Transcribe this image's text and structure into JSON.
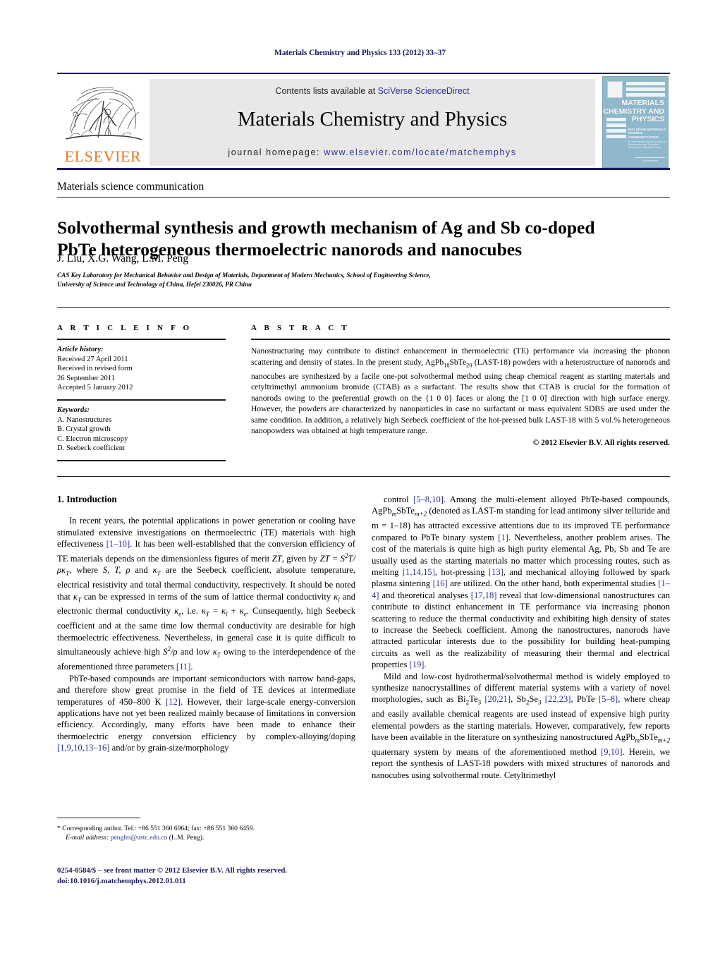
{
  "running_head": "Materials Chemistry and Physics 133 (2012) 33–37",
  "header": {
    "contents_prefix": "Contents lists available at ",
    "contents_link": "SciVerse ScienceDirect",
    "journal_name": "Materials Chemistry and Physics",
    "homepage_prefix": "journal homepage: ",
    "homepage_link": "www.elsevier.com/locate/matchemphys",
    "publisher_wordmark": "ELSEVIER",
    "publisher_color": "#e87722",
    "link_color": "#2e3192",
    "rule_color": "#1b1b5e",
    "banner_bg": "#e8e8e8"
  },
  "cover": {
    "title_line1": "MATERIALS",
    "title_line2": "CHEMISTRY AND",
    "title_line3": "PHYSICS",
    "subtitle": "INCLUDING MATERIALS SCIENCE COMMUNICATIONS",
    "fine_print": "An International Journal devoted to Experimental and Theoretical Research on Materials Science",
    "foot": "ScienceDirect",
    "bg_color": "#8fb8cc"
  },
  "article": {
    "section_label": "Materials science communication",
    "title": "Solvothermal synthesis and growth mechanism of Ag and Sb co-doped PbTe heterogeneous thermoelectric nanorods and nanocubes",
    "authors": "J. Liu, X.G. Wang, L.M. Peng",
    "corresponding_marker": "*",
    "affiliation_line1": "CAS Key Laboratory for Mechanical Behavior and Design of Materials, Department of Modern Mechanics, School of Engineering Science,",
    "affiliation_line2": "University of Science and Technology of China, Hefei 230026, PR China"
  },
  "article_info": {
    "heading": "A R T I C L E   I N F O",
    "history_label": "Article history:",
    "history": [
      "Received 27 April 2011",
      "Received in revised form",
      "26 September 2011",
      "Accepted 5 January 2012"
    ],
    "keywords_label": "Keywords:",
    "keywords": [
      "A. Nanostructures",
      "B. Crystal growth",
      "C. Electron microscopy",
      "D. Seebeck coefficient"
    ]
  },
  "abstract": {
    "heading": "A B S T R A C T",
    "text_part1": "Nanostructuring may contribute to distinct enhancement in thermoelectric (TE) performance via increasing the phonon scattering and density of states. In the present study, AgPb",
    "sub1": "18",
    "text_part2": "SbTe",
    "sub2": "20",
    "text_part3": " (LAST-18) powders with a heterostructure of nanorods and nanocubes are synthesized by a facile one-pot solvothermal method using cheap chemical reagent as starting materials and cetyltrimethyl ammonium bromide (CTAB) as a surfactant. The results show that CTAB is crucial for the formation of nanorods owing to the preferential growth on the {1 0 0} faces or along the [1 0 0] direction with high surface energy. However, the powders are characterized by nanoparticles in case no surfactant or mass equivalent SDBS are used under the same condition. In addition, a relatively high Seebeck coefficient of the hot-pressed bulk LAST-18 with 5 vol.% heterogeneous nanopowders was obtained at high temperature range.",
    "copyright": "© 2012 Elsevier B.V. All rights reserved."
  },
  "body": {
    "section_heading": "1.  Introduction",
    "left_p1_a": "In recent years, the potential applications in power generation or cooling have stimulated extensive investigations on thermoelectric (TE) materials with high effectiveness ",
    "left_p1_ref1": "[1–10]",
    "left_p1_b": ". It has been well-established that the conversion efficiency of TE materials depends on the dimensionless figures of merit ",
    "left_p1_zt": "ZT",
    "left_p1_c": ", given by ",
    "left_p1_eq": "ZT = S",
    "left_p1_eq_sup": "2",
    "left_p1_eq2": "T/ρκ",
    "left_p1_eq2_sub": "T",
    "left_p1_d": ", where ",
    "left_p1_vars": "S, T, ρ",
    "left_p1_e": " and ",
    "left_p1_kt": "κ",
    "left_p1_kt_sub": "T",
    "left_p1_f": " are the Seebeck coefficient, absolute temperature, electrical resistivity and total thermal conductivity, respectively. It should be noted that ",
    "left_p1_g": " can be expressed in terms of the sum of lattice thermal conductivity ",
    "left_p1_kl": "κ",
    "left_p1_kl_sub": "l",
    "left_p1_h": " and electronic thermal conductivity ",
    "left_p1_ke": "κ",
    "left_p1_ke_sub": "e",
    "left_p1_i": ", i.e. ",
    "left_p1_j": " = ",
    "left_p1_k": " + ",
    "left_p1_l": ". Consequently, high Seebeck coefficient and at the same time low thermal conductivity are desirable for high thermoelectric effectiveness. Nevertheless, in general case it is quite difficult to simultaneously achieve high ",
    "left_p1_s2": "S",
    "left_p1_s2_sup": "2",
    "left_p1_s2_b": "/ρ",
    "left_p1_m": " and low ",
    "left_p1_n": " owing to the interdependence of the aforementioned three parameters ",
    "left_p1_ref2": "[11]",
    "left_p1_o": ".",
    "left_p2_a": "PbTe-based compounds are important semiconductors with narrow band-gaps, and therefore show great promise in the field of TE devices at intermediate temperatures of 450–800 K ",
    "left_p2_ref": "[12]",
    "left_p2_b": ". However, their large-scale energy-conversion applications have not yet been realized mainly because of limitations in conversion efficiency. Accordingly, many efforts have been made to enhance their thermoelectric energy conversion efficiency by complex-alloying/doping ",
    "left_p2_ref2": "[1,9,10,13–16]",
    "left_p2_c": " and/or by grain-size/morphology",
    "right_p1_a": "control ",
    "right_p1_ref1": "[5–8,10]",
    "right_p1_b": ". Among the multi-element alloyed PbTe-based compounds, AgPb",
    "right_p1_subm": "m",
    "right_p1_c": "SbTe",
    "right_p1_subm2": "m+2",
    "right_p1_d": " (denoted as LAST-m standing for lead antimony silver telluride and m = 1–18) has attracted excessive attentions due to its improved TE performance compared to PbTe binary system ",
    "right_p1_ref2": "[1]",
    "right_p1_e": ". Nevertheless, another problem arises. The cost of the materials is quite high as high purity elemental Ag, Pb, Sb and Te are usually used as the starting materials no matter which processing routes, such as melting ",
    "right_p1_ref3": "[1,14,15]",
    "right_p1_f": ", hot-pressing ",
    "right_p1_ref4": "[13]",
    "right_p1_g": ", and mechanical alloying followed by spark plasma sintering ",
    "right_p1_ref5": "[16]",
    "right_p1_h": " are utilized. On the other hand, both experimental studies ",
    "right_p1_ref6": "[1–4]",
    "right_p1_i": " and theoretical analyses ",
    "right_p1_ref7": "[17,18]",
    "right_p1_j": " reveal that low-dimensional nanostructures can contribute to distinct enhancement in TE performance via increasing phonon scattering to reduce the thermal conductivity and exhibiting high density of states to increase the Seebeck coefficient. Among the nanostructures, nanorods have attracted particular interests due to the possibility for building heat-pumping circuits as well as the realizability of measuring their thermal and electrical properties ",
    "right_p1_ref8": "[19]",
    "right_p1_k": ".",
    "right_p2_a": "Mild and low-cost hydrothermal/solvothermal method is widely employed to synthesize nanocrystallines of different material systems with a variety of novel morphologies, such as Bi",
    "right_p2_sub1": "2",
    "right_p2_b": "Te",
    "right_p2_sub2": "3",
    "right_p2_ref1": "[20,21]",
    "right_p2_c": ", Sb",
    "right_p2_sub3": "2",
    "right_p2_d": "Se",
    "right_p2_sub4": "3",
    "right_p2_ref2": "[22,23]",
    "right_p2_e": ", PbTe ",
    "right_p2_ref3": "[5–8]",
    "right_p2_f": ", where cheap and easily available chemical reagents are used instead of expensive high purity elemental powders as the starting materials. However, comparatively, few reports have been available in the literature on synthesizing nanostructured AgPb",
    "right_p2_subm": "m",
    "right_p2_g": "SbTe",
    "right_p2_subm2": "m+2",
    "right_p2_h": " quaternary system by means of the aforementioned method ",
    "right_p2_ref4": "[9,10]",
    "right_p2_i": ". Herein, we report the synthesis of LAST-18 powders with mixed structures of nanorods and nanocubes using solvothermal route. Cetyltrimethyl"
  },
  "footnote": {
    "marker": "*",
    "corresponding": " Corresponding author. Tel.: +86 551 360 6964; fax: +86 551 360 6459.",
    "email_label": "E-mail address:",
    "email": "penglm@ustc.edu.cn",
    "email_owner": " (L.M. Peng)."
  },
  "issn": {
    "line1": "0254-0584/$ – see front matter © 2012 Elsevier B.V. All rights reserved.",
    "line2": "doi:10.1016/j.matchemphys.2012.01.011"
  }
}
